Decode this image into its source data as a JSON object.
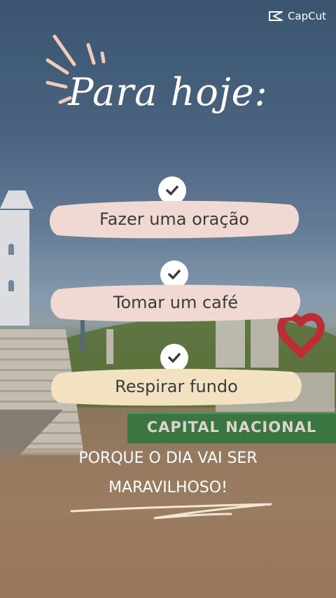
{
  "logo": {
    "text": "CapCut"
  },
  "title": "Para hoje:",
  "tasks": [
    {
      "label": "Fazer uma oração",
      "brush_color": "#f1d9d3"
    },
    {
      "label": "Tomar um café",
      "brush_color": "#f1d9d3"
    },
    {
      "label": "Respirar fundo",
      "brush_color": "#f3e2c2"
    }
  ],
  "footer": {
    "line1": "PORQUE O DIA VAI SER",
    "line2": "MARAVILHOSO!"
  },
  "background": {
    "sign_text": "CAPITAL NACIONAL"
  },
  "colors": {
    "accent": "#f0cbbb",
    "check_bg": "#ffffff",
    "check_mark": "#3d3d3d"
  }
}
